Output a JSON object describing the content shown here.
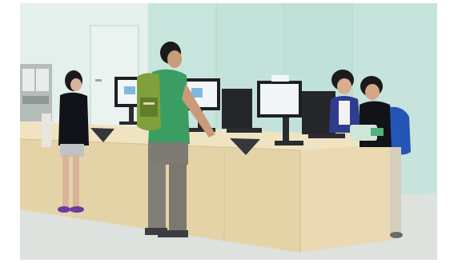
{
  "image": {
    "type": "photograph",
    "scene_objects": [
      "glass-wall",
      "door",
      "wall-panel",
      "service-counter",
      "computer-monitor",
      "standing-person",
      "backpack",
      "floor"
    ],
    "colors": {
      "wall": "#cfe9e1",
      "glass_panel": "#c3e3da",
      "counter_wood": "#e7d6ae",
      "counter_top": "#efe2c0",
      "floor": "#d8ddd8",
      "monitor": "#1e1f22",
      "screen": "#f3f6f9",
      "green_shirt": "#3a9d63",
      "backpack_green": "#7fa03a",
      "blue_backpack": "#2456b8",
      "black_top": "#111318"
    }
  }
}
